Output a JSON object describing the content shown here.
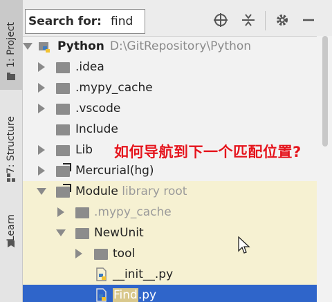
{
  "side_tabs": [
    {
      "label": "1: Project",
      "mnemonic": "1"
    },
    {
      "label": "7: Structure",
      "mnemonic": "7"
    },
    {
      "label": "Learn"
    }
  ],
  "search": {
    "label": "Search for:",
    "value": "find"
  },
  "toolbar_icons": [
    "crosshair-icon",
    "collapse-icon",
    "gear-icon",
    "minimize-icon"
  ],
  "tree": {
    "root": {
      "name": "Python",
      "path": "D:\\GitRepository\\Python"
    },
    "items": [
      {
        "name": ".idea"
      },
      {
        "name": ".mypy_cache"
      },
      {
        "name": ".vscode"
      },
      {
        "name": "Include"
      },
      {
        "name": "Lib"
      },
      {
        "name": "Mercurial(hg)"
      },
      {
        "name": "Module",
        "note": "library root"
      },
      {
        "name": ".mypy_cache"
      },
      {
        "name": "NewUnit"
      },
      {
        "name": "tool"
      },
      {
        "name": "__init__.py"
      },
      {
        "name_match": "Find",
        "name_rest": ".py"
      }
    ]
  },
  "annotation": "如何导航到下一个匹配位置?"
}
